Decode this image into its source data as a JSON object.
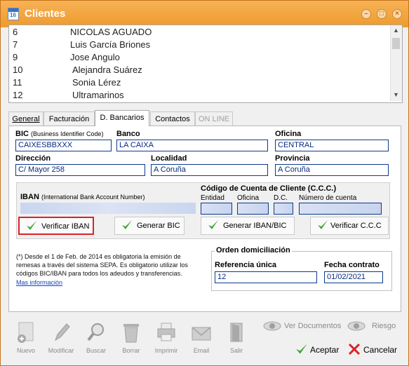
{
  "window": {
    "title": "Clientes",
    "icon_number": "16"
  },
  "clients": [
    {
      "id": "6",
      "name": "NICOLAS AGUADO"
    },
    {
      "id": "7",
      "name": "Luis García Briones"
    },
    {
      "id": "9",
      "name": "Jose Angulo"
    },
    {
      "id": "10",
      "name": "Alejandra Suárez"
    },
    {
      "id": "11",
      "name": "Sonia Lérez"
    },
    {
      "id": "12",
      "name": "Ultramarinos"
    }
  ],
  "tabs": {
    "general": "General",
    "facturacion": "Facturación",
    "bancarios": "D. Bancarios",
    "contactos": "Contactos",
    "online": "ON LINE"
  },
  "bank": {
    "bic_label": "BIC",
    "bic_hint": "(Business Identifier Code)",
    "bic_value": "CAIXESBBXXX",
    "banco_label": "Banco",
    "banco_value": "LA CAIXA",
    "oficina_label": "Oficina",
    "oficina_value": "CENTRAL",
    "direccion_label": "Dirección",
    "direccion_value": "C/ Mayor 258",
    "localidad_label": "Localidad",
    "localidad_value": "A Coruña",
    "provincia_label": "Provincia",
    "provincia_value": "A Coruña"
  },
  "iban": {
    "label": "IBAN",
    "hint": "(International Bank Account Number)",
    "ccc_title": "Código de Cuenta de Cliente (C.C.C.)",
    "ccc_entidad": "Entidad",
    "ccc_oficina": "Oficina",
    "ccc_dc": "D.C.",
    "ccc_numero": "Número de cuenta",
    "btn_verificar_iban": "Verificar IBAN",
    "btn_generar_bic": "Generar BIC",
    "btn_generar_iban_bic": "Generar IBAN/BIC",
    "btn_verificar_ccc": "Verificar C.C.C"
  },
  "note": {
    "text": "(*) Desde el 1 de Feb. de 2014 es obligatoria la emisión de remesas a través del sistema SEPA. Es obligatorio utilizar los códigos BIC/IBAN para todos los adeudos y transferencias.",
    "link": "Mas información"
  },
  "orden": {
    "title": "Orden domiciliación",
    "ref_label": "Referencia única",
    "ref_value": "12",
    "fecha_label": "Fecha contrato",
    "fecha_value": "01/02/2021"
  },
  "toolbar": {
    "nuevo": "Nuevo",
    "modificar": "Modificar",
    "buscar": "Buscar",
    "borrar": "Borrar",
    "imprimir": "Imprimir",
    "email": "Email",
    "salir": "Salir",
    "ver_documentos": "Ver Documentos",
    "riesgo": "Riesgo",
    "aceptar": "Aceptar",
    "cancelar": "Cancelar"
  },
  "colors": {
    "titlebar": "#f19f33",
    "field_border": "#0a3a8c",
    "highlight": "#d9232a",
    "check": "#3fa535"
  }
}
